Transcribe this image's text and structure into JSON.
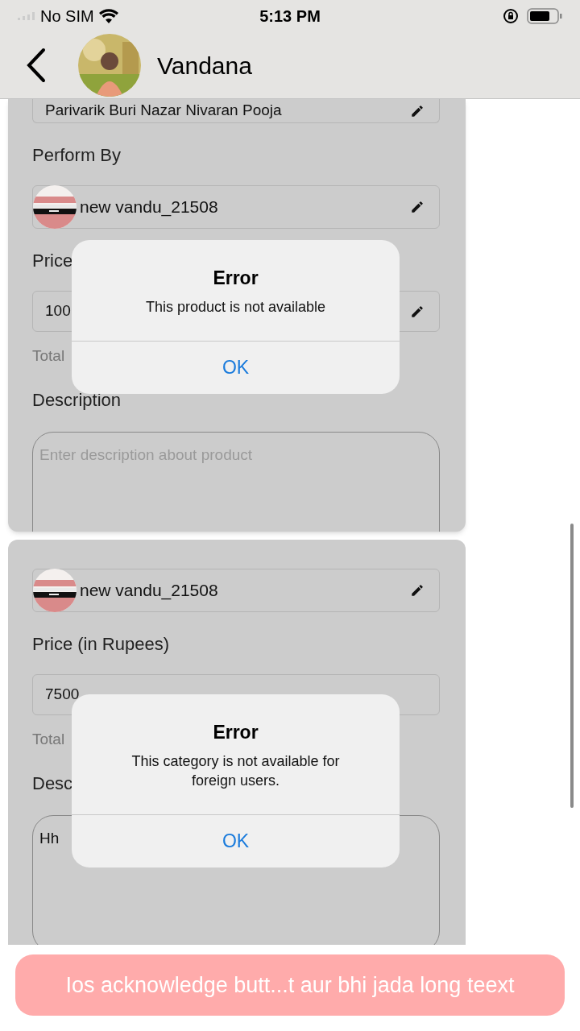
{
  "status_bar": {
    "carrier": "No SIM",
    "time": "5:13 PM"
  },
  "header": {
    "title": "Vandana"
  },
  "cards": [
    {
      "items": [
        {
          "kind": "field",
          "value": "Parivarik Buri Nazar Nivaran Pooja",
          "editable": true
        },
        {
          "kind": "label",
          "text": "Perform By"
        },
        {
          "kind": "profile",
          "value": "new vandu_21508",
          "editable": true
        },
        {
          "kind": "label",
          "text": "Price"
        },
        {
          "kind": "field",
          "value": "100",
          "editable": true
        },
        {
          "kind": "note",
          "text": "Total"
        },
        {
          "kind": "label",
          "text": "Description"
        },
        {
          "kind": "textarea",
          "placeholder": "Enter description about product"
        }
      ]
    },
    {
      "items": [
        {
          "kind": "profile",
          "value": "new vandu_21508",
          "editable": true
        },
        {
          "kind": "label",
          "text": "Price (in Rupees)"
        },
        {
          "kind": "field",
          "value": "7500",
          "editable": false
        },
        {
          "kind": "note",
          "text": "Total"
        },
        {
          "kind": "label",
          "text": "Desc"
        },
        {
          "kind": "textarea",
          "value": "Hh"
        }
      ]
    }
  ],
  "alerts": [
    {
      "title": "Error",
      "message": "This product is not available",
      "button": "OK"
    },
    {
      "title": "Error",
      "message": "This category is not available for foreign users.",
      "button": "OK"
    }
  ],
  "toast": {
    "text": "Ios acknowledge butt...t aur bhi jada long teext"
  }
}
